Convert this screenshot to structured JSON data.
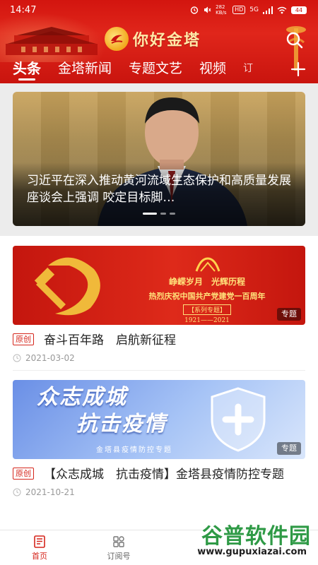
{
  "status_bar": {
    "time": "14:47",
    "network_speed": "282 KB/s",
    "hd_label": "HD",
    "signal_label": "5G",
    "battery": "44"
  },
  "header": {
    "app_title": "你好金塔",
    "search_icon": "search-icon",
    "add_icon": "plus-icon"
  },
  "tabs": [
    {
      "label": "头条",
      "active": true
    },
    {
      "label": "金塔新闻",
      "active": false
    },
    {
      "label": "专题文艺",
      "active": false
    },
    {
      "label": "视频",
      "active": false
    },
    {
      "label": "订",
      "active": false
    }
  ],
  "carousel": {
    "caption": "习近平在深入推动黄河流域生态保护和高质量发展座谈会上强调 咬定目标脚…",
    "slide_count": 3,
    "active_index": 0
  },
  "feed": [
    {
      "tag": "原创",
      "title": "奋斗百年路　启航新征程",
      "date": "2021-03-02",
      "badge": "专题",
      "banner": {
        "line1": "峥嵘岁月　光辉历程",
        "line2": "热烈庆祝中国共产党建党一百周年",
        "line3": "【系列专题】",
        "line4": "1921——2021"
      }
    },
    {
      "tag": "原创",
      "title": "【众志成城　抗击疫情】金塔县疫情防控专题",
      "date": "2021-10-21",
      "badge": "专题",
      "banner": {
        "title_line1": "众志成城",
        "title_line2": "抗击疫情",
        "subtitle": "金塔县疫情防控专题"
      }
    }
  ],
  "bottom_nav": [
    {
      "label": "首页",
      "icon": "newspaper-icon",
      "active": true
    },
    {
      "label": "订阅号",
      "icon": "grid-icon",
      "active": false
    }
  ],
  "watermark": {
    "brand": "谷普软件园",
    "url": "www.gupuxiazai.com"
  },
  "colors": {
    "brand_red": "#d5251b",
    "header_red": "#d3150f",
    "text_gray": "#999999"
  }
}
